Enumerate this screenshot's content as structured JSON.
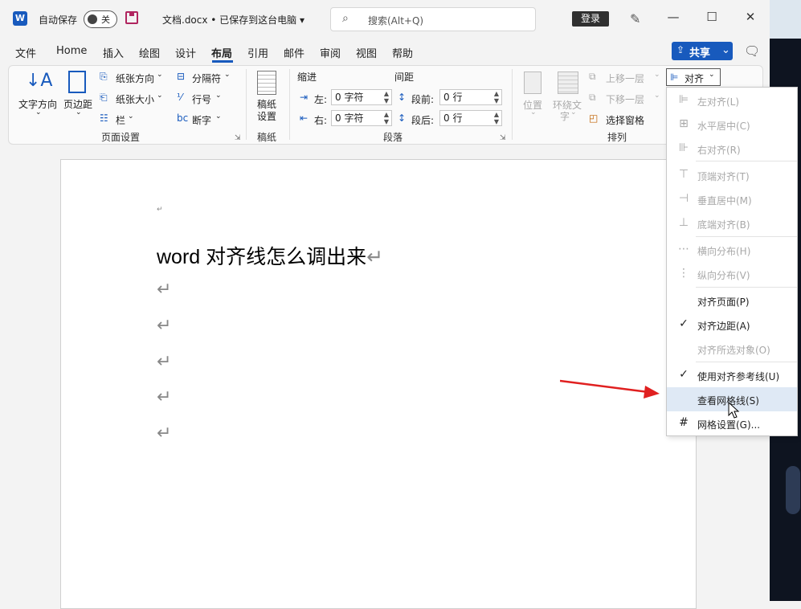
{
  "titlebar": {
    "app_icon": "W",
    "autosave_label": "自动保存",
    "autosave_state": "关",
    "doc_title": "文档.docx • 已保存到这台电脑 ▾",
    "search_placeholder": "搜索(Alt+Q)",
    "login_label": "登录",
    "window_buttons": [
      "—",
      "☐",
      "✕"
    ]
  },
  "tabs": [
    "文件",
    "Home",
    "插入",
    "绘图",
    "设计",
    "布局",
    "引用",
    "邮件",
    "审阅",
    "视图",
    "帮助"
  ],
  "active_tab": "布局",
  "share_label": "共享",
  "ribbon": {
    "page_setup": {
      "text_direction": "文字方向",
      "margins": "页边距",
      "orientation": "纸张方向",
      "size": "纸张大小",
      "columns": "栏",
      "breaks": "分隔符",
      "line_numbers": "行号",
      "hyphenation": "断字",
      "group": "页面设置"
    },
    "manuscript": {
      "label1": "稿纸",
      "label2": "设置",
      "group": "稿纸"
    },
    "paragraph": {
      "indent_title": "缩进",
      "spacing_title": "间距",
      "left_label": "左:",
      "left_value": "0 字符",
      "right_label": "右:",
      "right_value": "0 字符",
      "before_label": "段前:",
      "before_value": "0 行",
      "after_label": "段后:",
      "after_value": "0 行",
      "group": "段落"
    },
    "arrange": {
      "position": "位置",
      "wrap1": "环绕文",
      "wrap2": "字",
      "bring_forward": "上移一层",
      "send_backward": "下移一层",
      "selection_pane": "选择窗格",
      "align": "对齐",
      "group": "排列"
    }
  },
  "document": {
    "first_mark": "↵",
    "heading": "word 对齐线怎么调出来",
    "heading_mark": "↵",
    "para_mark": "↵"
  },
  "menu": {
    "items": [
      {
        "label": "左对齐(L)",
        "icon": "align-left-icon",
        "glyph": "⊫",
        "disabled": true
      },
      {
        "label": "水平居中(C)",
        "icon": "align-center-icon",
        "glyph": "⊞",
        "disabled": true
      },
      {
        "label": "右对齐(R)",
        "icon": "align-right-icon",
        "glyph": "⊪",
        "disabled": true
      },
      {
        "label": "顶端对齐(T)",
        "icon": "align-top-icon",
        "glyph": "⊤",
        "disabled": true
      },
      {
        "label": "垂直居中(M)",
        "icon": "align-middle-icon",
        "glyph": "⊣",
        "disabled": true
      },
      {
        "label": "底端对齐(B)",
        "icon": "align-bottom-icon",
        "glyph": "⊥",
        "disabled": true
      },
      {
        "label": "横向分布(H)",
        "icon": "distribute-horizontal-icon",
        "glyph": "⋯",
        "disabled": true
      },
      {
        "label": "纵向分布(V)",
        "icon": "distribute-vertical-icon",
        "glyph": "⋮",
        "disabled": true
      },
      {
        "label": "对齐页面(P)",
        "icon": "",
        "glyph": "",
        "disabled": false
      },
      {
        "label": "对齐边距(A)",
        "icon": "check-icon",
        "glyph": "✓",
        "disabled": false
      },
      {
        "label": "对齐所选对象(O)",
        "icon": "",
        "glyph": "",
        "disabled": true
      },
      {
        "label": "使用对齐参考线(U)",
        "icon": "check-icon",
        "glyph": "✓",
        "disabled": false
      },
      {
        "label": "查看网格线(S)",
        "icon": "",
        "glyph": "",
        "disabled": false,
        "highlighted": true
      },
      {
        "label": "网格设置(G)...",
        "icon": "grid-icon",
        "glyph": "#",
        "disabled": false
      }
    ]
  },
  "colors": {
    "accent": "#185abd",
    "arrow": "#e02020",
    "menu_highlight": "#dfe9f5"
  }
}
